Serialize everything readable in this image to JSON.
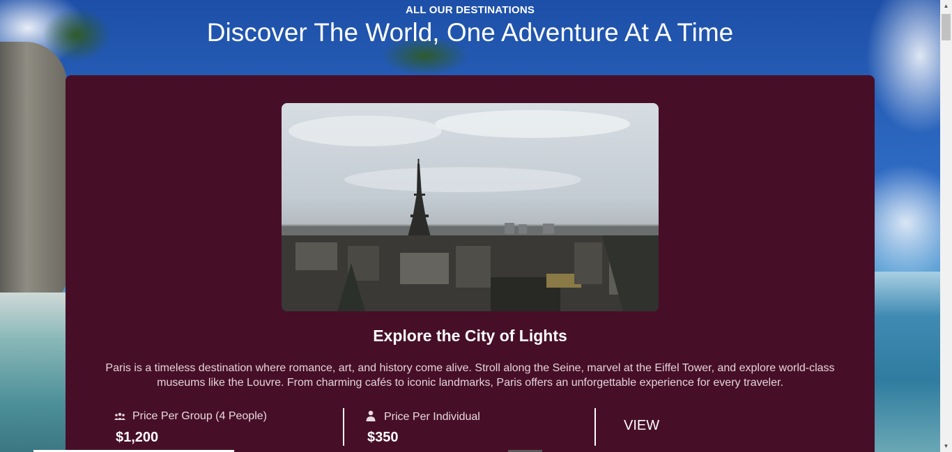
{
  "header": {
    "eyebrow": "ALL OUR DESTINATIONS",
    "headline": "Discover The World, One Adventure At A Time"
  },
  "destination": {
    "image_subject": "Paris skyline with Eiffel Tower",
    "title": "Explore the City of Lights",
    "description": "Paris is a timeless destination where romance, art, and history come alive. Stroll along the Seine, marvel at the Eiffel Tower, and explore world-class museums like the Louvre. From charming cafés to iconic landmarks, Paris offers an unforgettable experience for every traveler.",
    "group_price": {
      "icon": "group-icon",
      "label": "Price Per Group (4 People)",
      "value": "$1,200"
    },
    "individual_price": {
      "icon": "person-icon",
      "label": "Price Per Individual",
      "value": "$350"
    },
    "view_label": "VIEW"
  },
  "colors": {
    "card_background": "#470f27",
    "text_primary": "#ffffff"
  }
}
